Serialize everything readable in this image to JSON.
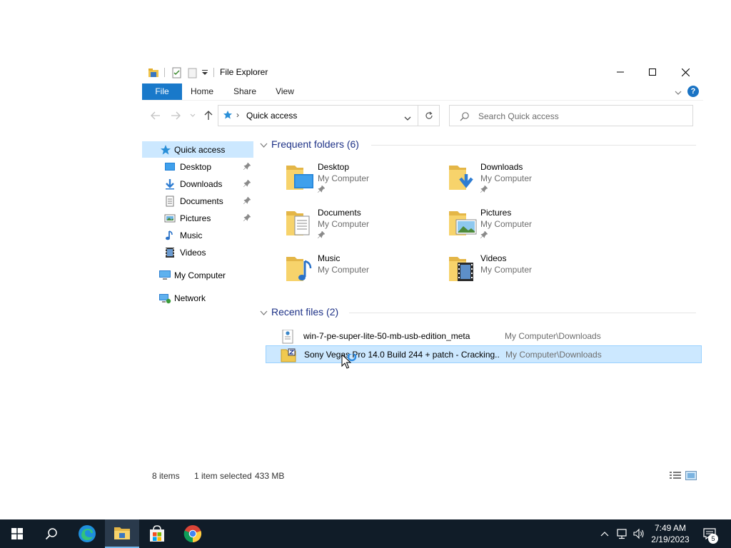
{
  "window": {
    "title": "File Explorer",
    "controls": {
      "minimize_icon": "minimize-icon",
      "maximize_icon": "maximize-icon",
      "close_icon": "close-icon"
    }
  },
  "ribbon": {
    "tabs": [
      {
        "label": "File"
      },
      {
        "label": "Home"
      },
      {
        "label": "Share"
      },
      {
        "label": "View"
      }
    ],
    "help_label": "?"
  },
  "address": {
    "location": "Quick access",
    "separator": "›",
    "search_placeholder": "Search Quick access"
  },
  "nav_pane": {
    "quick_access": "Quick access",
    "pinned": [
      {
        "label": "Desktop",
        "icon": "desktop-icon",
        "pinned": true
      },
      {
        "label": "Downloads",
        "icon": "download-icon",
        "pinned": true
      },
      {
        "label": "Documents",
        "icon": "document-icon",
        "pinned": true
      },
      {
        "label": "Pictures",
        "icon": "picture-icon",
        "pinned": true
      },
      {
        "label": "Music",
        "icon": "music-icon",
        "pinned": false
      },
      {
        "label": "Videos",
        "icon": "video-icon",
        "pinned": false
      }
    ],
    "my_computer": "My Computer",
    "network": "Network"
  },
  "frequent": {
    "header": "Frequent folders (6)",
    "folders": [
      {
        "name": "Desktop",
        "location": "My Computer",
        "pinned": true
      },
      {
        "name": "Downloads",
        "location": "My Computer",
        "pinned": true
      },
      {
        "name": "Documents",
        "location": "My Computer",
        "pinned": true
      },
      {
        "name": "Pictures",
        "location": "My Computer",
        "pinned": true
      },
      {
        "name": "Music",
        "location": "My Computer",
        "pinned": false
      },
      {
        "name": "Videos",
        "location": "My Computer",
        "pinned": false
      }
    ]
  },
  "recent": {
    "header": "Recent files (2)",
    "files": [
      {
        "name": "win-7-pe-super-lite-50-mb-usb-edition_meta",
        "path": "My Computer\\Downloads",
        "selected": false
      },
      {
        "name": "Sony Vegas Pro 14.0 Build 244 + patch - Cracking...",
        "path": "My Computer\\Downloads",
        "selected": true
      }
    ]
  },
  "status": {
    "item_count": "8 items",
    "selection": "1 item selected",
    "size": "433 MB"
  },
  "taskbar": {
    "apps": [
      "start-icon",
      "search-icon",
      "edge-icon",
      "file-explorer-icon",
      "store-icon",
      "chrome-icon"
    ],
    "time": "7:49 AM",
    "date": "2/19/2023",
    "notification_count": "5"
  },
  "colors": {
    "accent": "#1979ca",
    "selection": "#cce8ff",
    "group_header": "#1e3287",
    "folder": "#f7d36b",
    "taskbar": "#101c28"
  }
}
